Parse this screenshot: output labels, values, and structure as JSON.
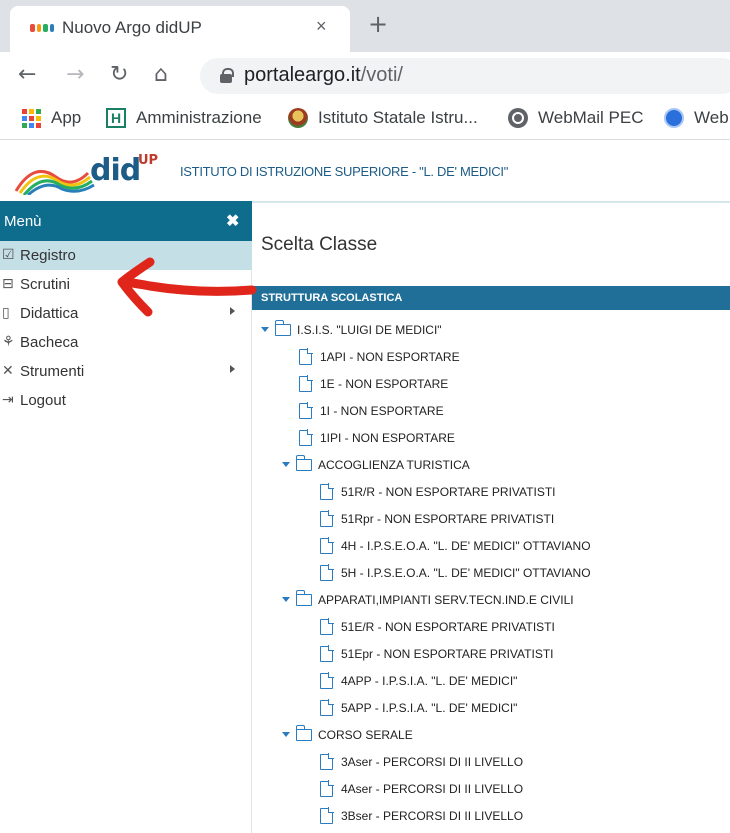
{
  "browser": {
    "tab_title": "Nuovo Argo didUP",
    "tab_close": "×",
    "new_tab": "+",
    "url_host": "portaleargo.it",
    "url_path": "/voti/",
    "bookmarks": [
      {
        "label": "App",
        "icon": "apps-icon"
      },
      {
        "label": "Amministrazione",
        "icon": "h-icon"
      },
      {
        "label": "Istituto Statale Istru...",
        "icon": "crest-icon"
      },
      {
        "label": "WebMail PEC",
        "icon": "globe-icon"
      },
      {
        "label": "Web",
        "icon": "web-icon"
      }
    ]
  },
  "header": {
    "logo_did": "did",
    "logo_up": "UP",
    "school_name": "ISTITUTO DI ISTRUZIONE SUPERIORE - \"L. DE' MEDICI\""
  },
  "sidebar": {
    "title": "Menù",
    "close": "✖",
    "items": [
      {
        "label": "Registro",
        "icon": "register-icon",
        "active": true,
        "submenu": false
      },
      {
        "label": "Scrutini",
        "icon": "scrutini-icon",
        "active": false,
        "submenu": false
      },
      {
        "label": "Didattica",
        "icon": "book-icon",
        "active": false,
        "submenu": true
      },
      {
        "label": "Bacheca",
        "icon": "bulletin-icon",
        "active": false,
        "submenu": false
      },
      {
        "label": "Strumenti",
        "icon": "tools-icon",
        "active": false,
        "submenu": true
      },
      {
        "label": "Logout",
        "icon": "logout-icon",
        "active": false,
        "submenu": false
      }
    ]
  },
  "main": {
    "page_title": "Scelta Classe",
    "section_title": "STRUTTURA SCOLASTICA",
    "tree": [
      {
        "type": "folder",
        "level": 0,
        "label": "I.S.I.S. \"LUIGI DE MEDICI\""
      },
      {
        "type": "file",
        "level": 1,
        "label": "1API - NON ESPORTARE"
      },
      {
        "type": "file",
        "level": 1,
        "label": "1E - NON ESPORTARE"
      },
      {
        "type": "file",
        "level": 1,
        "label": "1I - NON ESPORTARE"
      },
      {
        "type": "file",
        "level": 1,
        "label": "1IPI - NON ESPORTARE"
      },
      {
        "type": "folder",
        "level": 1,
        "label": "ACCOGLIENZA TURISTICA"
      },
      {
        "type": "file",
        "level": 2,
        "label": "51R/R - NON ESPORTARE PRIVATISTI"
      },
      {
        "type": "file",
        "level": 2,
        "label": "51Rpr - NON ESPORTARE PRIVATISTI"
      },
      {
        "type": "file",
        "level": 2,
        "label": "4H - I.P.S.E.O.A. \"L. DE' MEDICI\" OTTAVIANO"
      },
      {
        "type": "file",
        "level": 2,
        "label": "5H - I.P.S.E.O.A. \"L. DE' MEDICI\" OTTAVIANO"
      },
      {
        "type": "folder",
        "level": 1,
        "label": "APPARATI,IMPIANTI SERV.TECN.IND.E CIVILI"
      },
      {
        "type": "file",
        "level": 2,
        "label": "51E/R - NON ESPORTARE PRIVATISTI"
      },
      {
        "type": "file",
        "level": 2,
        "label": "51Epr - NON ESPORTARE PRIVATISTI"
      },
      {
        "type": "file",
        "level": 2,
        "label": "4APP - I.P.S.I.A. \"L. DE' MEDICI\""
      },
      {
        "type": "file",
        "level": 2,
        "label": "5APP - I.P.S.I.A. \"L. DE' MEDICI\""
      },
      {
        "type": "folder",
        "level": 1,
        "label": "CORSO SERALE"
      },
      {
        "type": "file",
        "level": 2,
        "label": "3Aser - PERCORSI DI II LIVELLO"
      },
      {
        "type": "file",
        "level": 2,
        "label": "4Aser - PERCORSI DI II LIVELLO"
      },
      {
        "type": "file",
        "level": 2,
        "label": "3Bser - PERCORSI DI II LIVELLO"
      }
    ]
  },
  "colors": {
    "menu_header": "#0e6c8c",
    "section_bar": "#1f6f99",
    "active_item": "#c4dfe6",
    "tree_icon": "#2a7bbf",
    "annotation_arrow": "#e0251b"
  }
}
